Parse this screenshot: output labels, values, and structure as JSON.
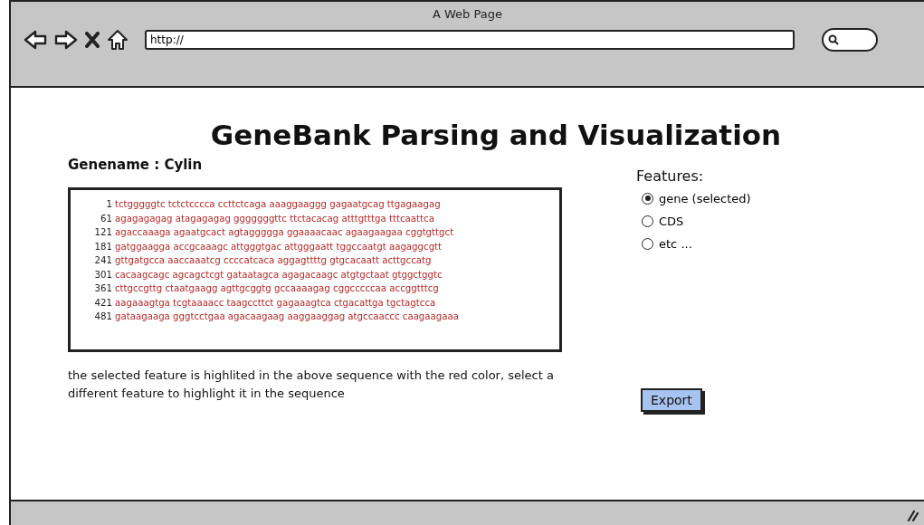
{
  "window": {
    "title": "A Web Page"
  },
  "address_bar": {
    "value": "http://"
  },
  "page": {
    "title": "GeneBank Parsing and Visualization",
    "genename": "Genename : Cylin",
    "sequence": [
      {
        "number": "1",
        "text": "tctgggggtc tctctcccca ccttctcaga aaaggaaggg gagaatgcag ttgagaagag",
        "highlighted": true
      },
      {
        "number": "61",
        "text": "agagagagag atagagagag gggggggttc ttctacacag atttgtttga tttcaattca",
        "highlighted": true
      },
      {
        "number": "121",
        "text": "agaccaaaga agaatgcact agtaggggga ggaaaacaac agaagaagaa cggtgttgct",
        "highlighted": true
      },
      {
        "number": "181",
        "text": "gatggaagga accgcaaagc attgggtgac attgggaatt tggccaatgt aagaggcgtt",
        "highlighted": true
      },
      {
        "number": "241",
        "text": "gttgatgcca aaccaaatcg ccccatcaca aggagttttg gtgcacaatt acttgccatg",
        "highlighted": true
      },
      {
        "number": "301",
        "text": "cacaagcagc agcagctcgt gataatagca agagacaagc atgtgctaat gtggctggtc",
        "highlighted": true
      },
      {
        "number": "361",
        "text": "cttgccgttg ctaatgaagg agttgcggtg gccaaaagag cggcccccaa accggtttcg",
        "highlighted": true
      },
      {
        "number": "421",
        "text": "aagaaagtga tcgtaaaacc taagccttct gagaaagtca ctgacattga tgctagtcca",
        "highlighted": true
      },
      {
        "number": "481",
        "text": "gataagaaga gggtcctgaa agacaagaag aaggaaggag atgccaaccc caagaagaaa",
        "highlighted": true
      }
    ],
    "description": "the selected feature is highlited in the above sequence with the red color, select a different feature to highlight it in the sequence",
    "features": {
      "label": "Features:",
      "options": [
        {
          "label": "gene (selected)",
          "selected": true
        },
        {
          "label": "CDS",
          "selected": false
        },
        {
          "label": "etc ...",
          "selected": false
        }
      ]
    },
    "export_button": "Export"
  }
}
